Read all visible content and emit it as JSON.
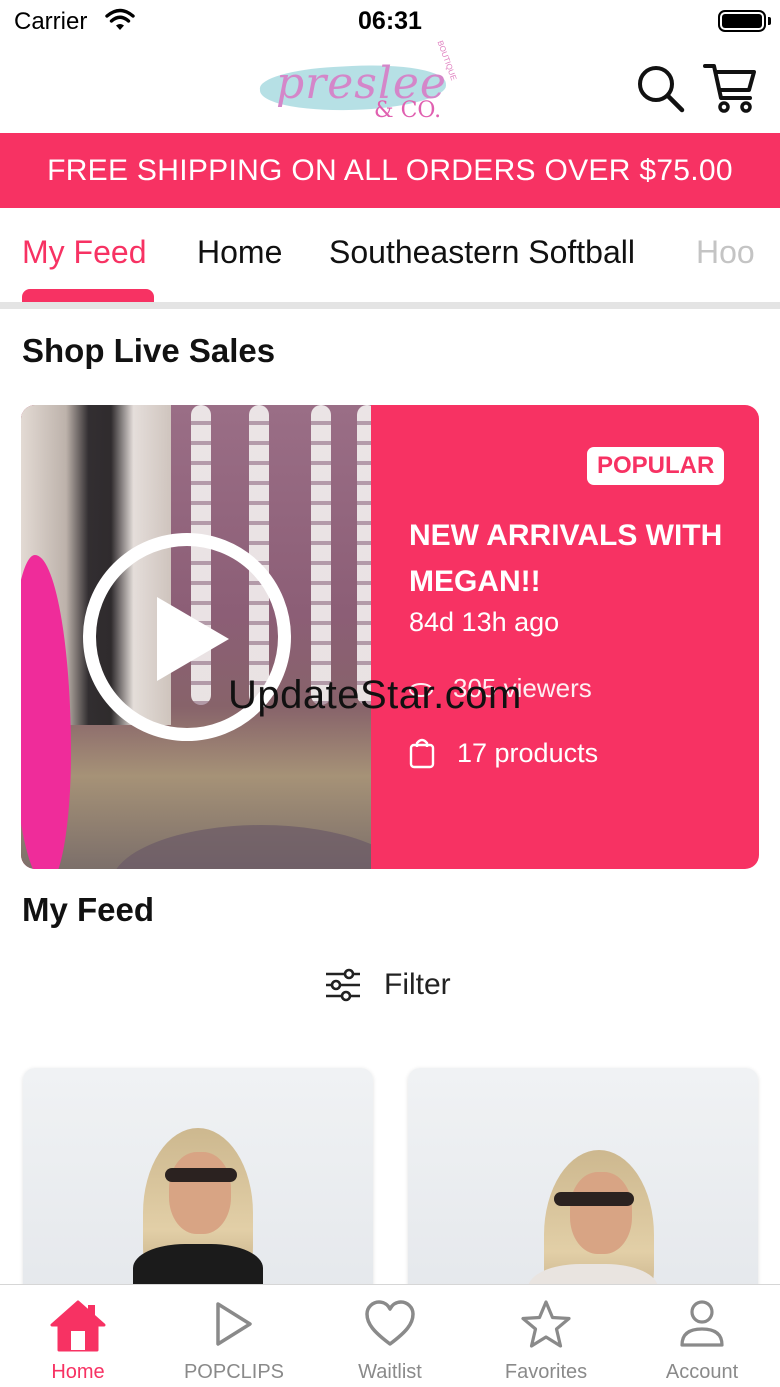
{
  "status_bar": {
    "carrier": "Carrier",
    "time": "06:31"
  },
  "header": {
    "logo_text": "preslee",
    "logo_sub": "& CO.",
    "logo_tag": "BOUTIQUE",
    "search_icon": "search-icon",
    "cart_icon": "cart-icon"
  },
  "promo": {
    "text": "FREE SHIPPING ON ALL ORDERS OVER $75.00"
  },
  "tabs": [
    {
      "label": "My Feed",
      "active": true
    },
    {
      "label": "Home",
      "active": false
    },
    {
      "label": "Southeastern Softball",
      "active": false
    },
    {
      "label": "Hoo",
      "active": false
    }
  ],
  "live_sales": {
    "section_title": "Shop Live Sales",
    "card": {
      "badge": "POPULAR",
      "title": "NEW ARRIVALS WITH MEGAN!!",
      "time_ago": "84d 13h ago",
      "viewers": "305 viewers",
      "products": "17 products"
    }
  },
  "watermark": "UpdateStar.com",
  "feed": {
    "section_title": "My Feed",
    "filter_label": "Filter"
  },
  "bottom_nav": [
    {
      "label": "Home",
      "icon": "home-icon",
      "active": true
    },
    {
      "label": "POPCLIPS",
      "icon": "play-icon",
      "active": false
    },
    {
      "label": "Waitlist",
      "icon": "heart-icon",
      "active": false
    },
    {
      "label": "Favorites",
      "icon": "star-icon",
      "active": false
    },
    {
      "label": "Account",
      "icon": "person-icon",
      "active": false
    }
  ],
  "colors": {
    "accent": "#f73263",
    "inactive": "#8a8a8a"
  }
}
